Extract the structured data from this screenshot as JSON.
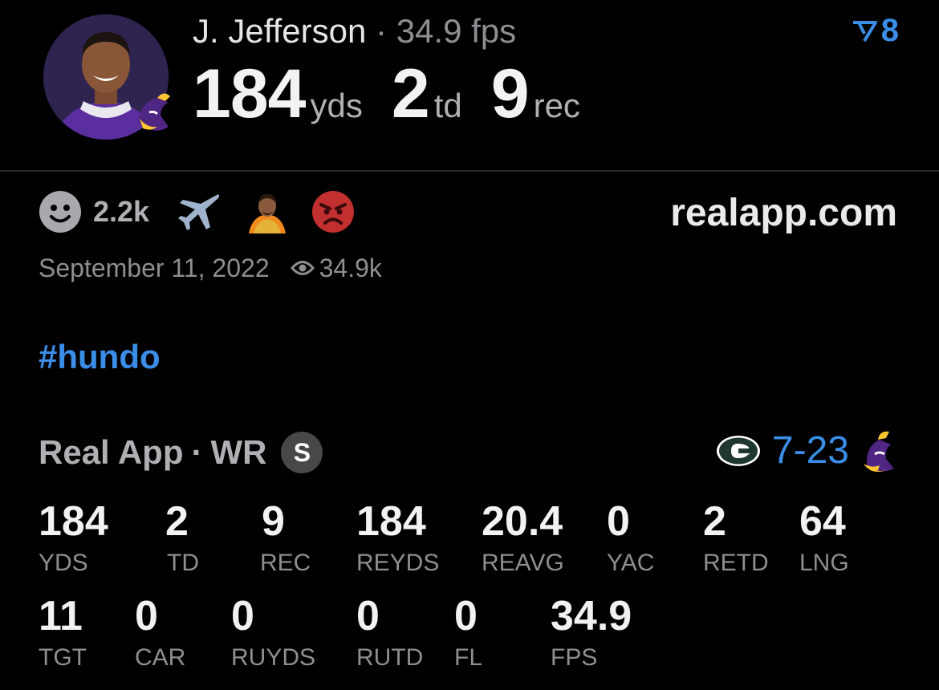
{
  "player": {
    "name": "J. Jefferson",
    "separator": "·",
    "fps": "34.9 fps"
  },
  "headline": [
    {
      "value": "184",
      "unit": "yds"
    },
    {
      "value": "2",
      "unit": "td"
    },
    {
      "value": "9",
      "unit": "rec"
    }
  ],
  "rank": {
    "icon": "rank-arrow-icon",
    "value": "8"
  },
  "reactions": {
    "count": "2.2k",
    "icons": [
      "smiley-icon",
      "airplane-icon",
      "drake-icon",
      "angry-face-icon"
    ]
  },
  "site": "realapp.com",
  "meta": {
    "date": "September 11, 2022",
    "views": "34.9k"
  },
  "hashtag": "#hundo",
  "source": {
    "app": "Real App",
    "separator": "·",
    "position": "WR",
    "badge": "S"
  },
  "game": {
    "score": "7-23",
    "home_icon": "packers-logo-icon",
    "away_icon": "vikings-logo-icon"
  },
  "stats_row1": [
    {
      "value": "184",
      "label": "YDS"
    },
    {
      "value": "2",
      "label": "TD"
    },
    {
      "value": "9",
      "label": "REC"
    },
    {
      "value": "184",
      "label": "REYDS"
    },
    {
      "value": "20.4",
      "label": "REAVG"
    },
    {
      "value": "0",
      "label": "YAC"
    },
    {
      "value": "2",
      "label": "RETD"
    },
    {
      "value": "64",
      "label": "LNG"
    }
  ],
  "stats_row2": [
    {
      "value": "11",
      "label": "TGT"
    },
    {
      "value": "0",
      "label": "CAR"
    },
    {
      "value": "0",
      "label": "RUYDS"
    },
    {
      "value": "0",
      "label": "RUTD"
    },
    {
      "value": "0",
      "label": "FL"
    },
    {
      "value": "34.9",
      "label": "FPS"
    }
  ],
  "colors": {
    "accent": "#3b8ee8",
    "muted": "#8e8e93",
    "background": "#000000",
    "vikings_purple": "#4f2683",
    "packers_green": "#203731"
  }
}
